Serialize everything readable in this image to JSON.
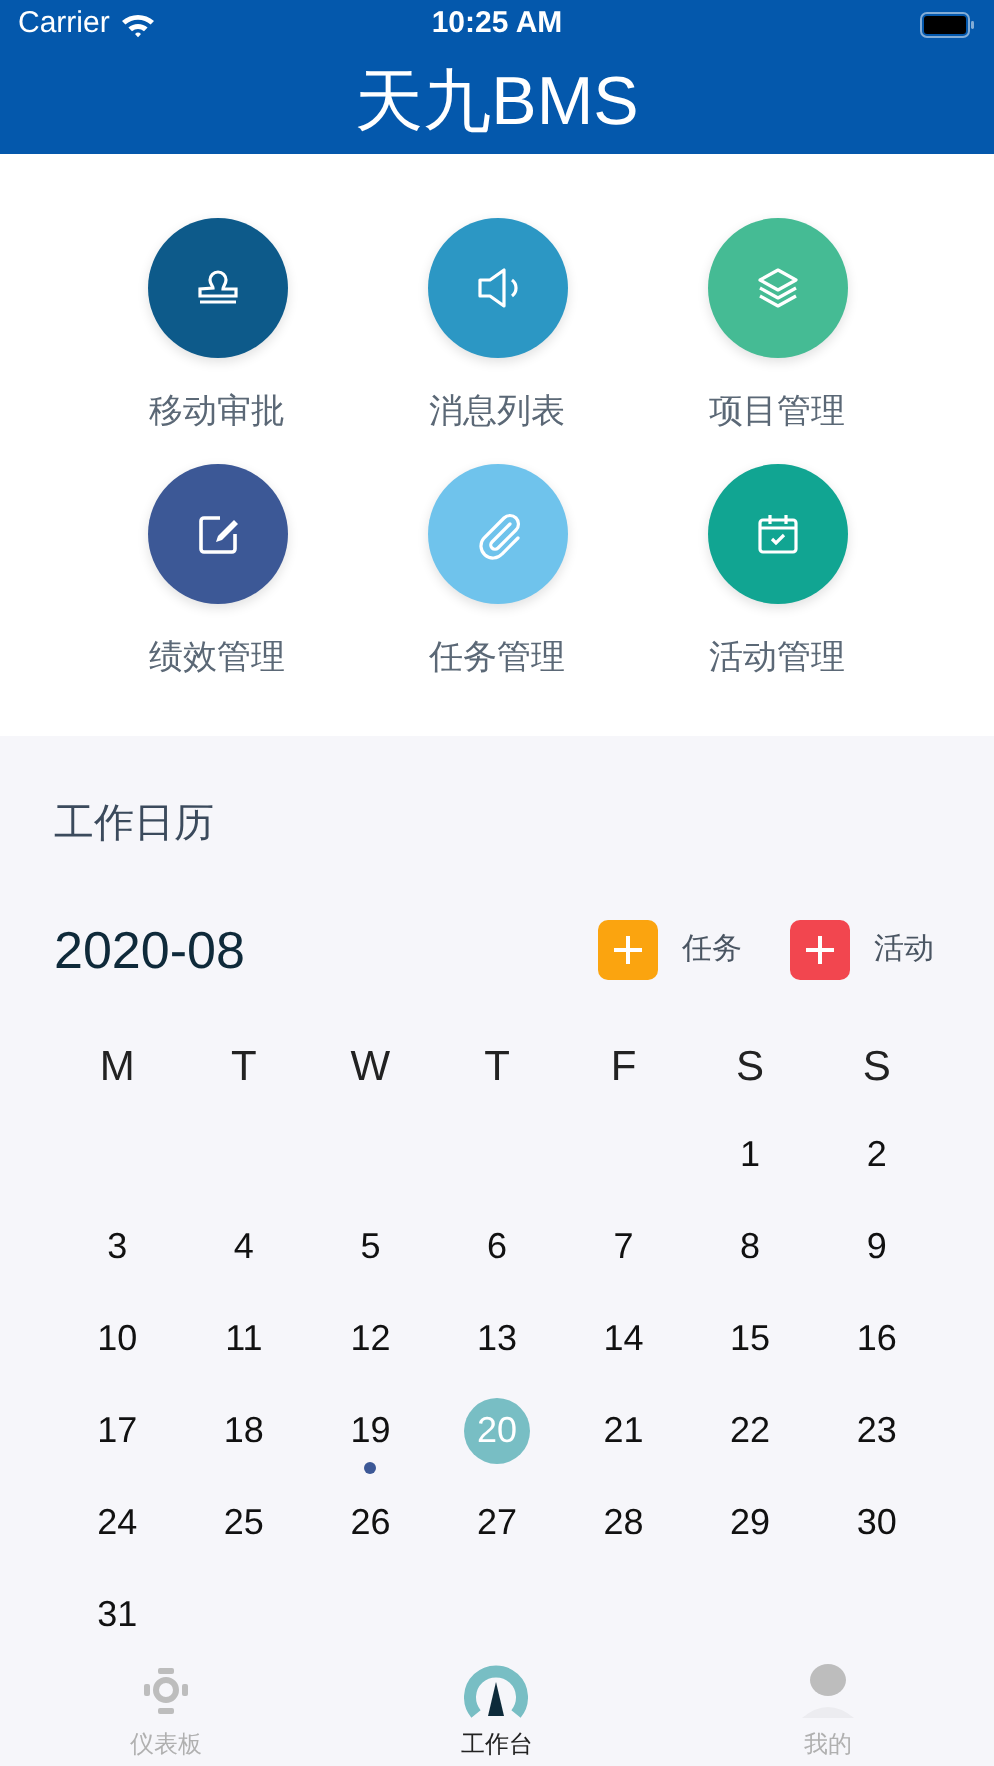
{
  "status_bar": {
    "carrier": "Carrier",
    "time": "10:25 AM"
  },
  "header": {
    "title": "天九BMS"
  },
  "shortcuts": [
    {
      "label": "移动审批",
      "kind": "stamp",
      "color": "#0d5a8a"
    },
    {
      "label": "消息列表",
      "kind": "speaker",
      "color": "#2c97c4"
    },
    {
      "label": "项目管理",
      "kind": "layers",
      "color": "#45bb94"
    },
    {
      "label": "绩效管理",
      "kind": "edit",
      "color": "#3c5896"
    },
    {
      "label": "任务管理",
      "kind": "clip",
      "color": "#6fc3ec"
    },
    {
      "label": "活动管理",
      "kind": "calendar",
      "color": "#11a592"
    }
  ],
  "calendar": {
    "title": "工作日历",
    "month": "2020-08",
    "add_buttons": [
      {
        "label": "任务",
        "color": "#fba40f"
      },
      {
        "label": "活动",
        "color": "#f2464f"
      }
    ],
    "weekdays": [
      "M",
      "T",
      "W",
      "T",
      "F",
      "S",
      "S"
    ],
    "weeks": [
      {
        "days": [
          {
            "day": "1",
            "selected": false,
            "has_event": false
          },
          {
            "day": "2",
            "selected": false,
            "has_event": false
          }
        ]
      },
      {
        "days": [
          {
            "day": "3",
            "selected": false,
            "has_event": false
          },
          {
            "day": "4",
            "selected": false,
            "has_event": false
          },
          {
            "day": "5",
            "selected": false,
            "has_event": false
          },
          {
            "day": "6",
            "selected": false,
            "has_event": false
          },
          {
            "day": "7",
            "selected": false,
            "has_event": false
          },
          {
            "day": "8",
            "selected": false,
            "has_event": false
          },
          {
            "day": "9",
            "selected": false,
            "has_event": false
          }
        ]
      },
      {
        "days": [
          {
            "day": "10",
            "selected": false,
            "has_event": false
          },
          {
            "day": "11",
            "selected": false,
            "has_event": false
          },
          {
            "day": "12",
            "selected": false,
            "has_event": false
          },
          {
            "day": "13",
            "selected": false,
            "has_event": false
          },
          {
            "day": "14",
            "selected": false,
            "has_event": false
          },
          {
            "day": "15",
            "selected": false,
            "has_event": false
          },
          {
            "day": "16",
            "selected": false,
            "has_event": false
          }
        ]
      },
      {
        "days": [
          {
            "day": "17",
            "selected": false,
            "has_event": false
          },
          {
            "day": "18",
            "selected": false,
            "has_event": false
          },
          {
            "day": "19",
            "selected": false,
            "has_event": true
          },
          {
            "day": "20",
            "selected": true,
            "has_event": false
          },
          {
            "day": "21",
            "selected": false,
            "has_event": false
          },
          {
            "day": "22",
            "selected": false,
            "has_event": false
          },
          {
            "day": "23",
            "selected": false,
            "has_event": false
          }
        ]
      },
      {
        "days": [
          {
            "day": "24",
            "selected": false,
            "has_event": false
          },
          {
            "day": "25",
            "selected": false,
            "has_event": false
          },
          {
            "day": "26",
            "selected": false,
            "has_event": false
          },
          {
            "day": "27",
            "selected": false,
            "has_event": false
          },
          {
            "day": "28",
            "selected": false,
            "has_event": false
          },
          {
            "day": "29",
            "selected": false,
            "has_event": false
          },
          {
            "day": "30",
            "selected": false,
            "has_event": false
          }
        ]
      },
      {
        "days": [
          {
            "day": "31",
            "selected": false,
            "has_event": false
          }
        ]
      }
    ]
  },
  "tab_bar": [
    {
      "label": "仪表板",
      "kind": "dashboard",
      "selected": false
    },
    {
      "label": "工作台",
      "kind": "gauge",
      "selected": true
    },
    {
      "label": "我的",
      "kind": "person",
      "selected": false
    }
  ]
}
